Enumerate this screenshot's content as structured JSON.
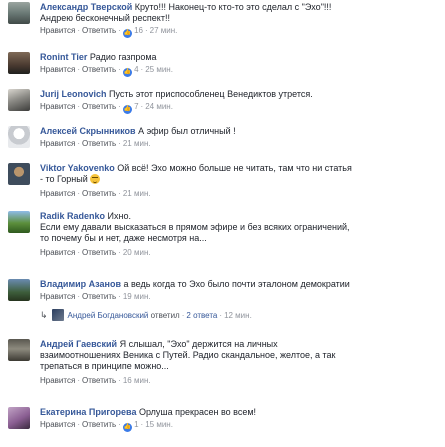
{
  "actions": {
    "like": "Нравится",
    "reply": "Ответить",
    "dot": "·"
  },
  "comments": [
    {
      "author": "Александр Тверской",
      "text": "Круто!!! Наконец-то кто-то это сделал с \"Эхо\"!!!",
      "text2": "Андрею бесконечный респект!!",
      "reactions": "16",
      "time": "27 мин."
    },
    {
      "author": "Ronint Tier",
      "text": "Радио газпрома",
      "reactions": "4",
      "time": "25 мин."
    },
    {
      "author": "Jurij Leonovich",
      "text": "Пусть этот приспособленец Венедиктов утрется.",
      "reactions": "7",
      "time": "24 мин."
    },
    {
      "author": "Алексей Скрынников",
      "text": "А эфир был отличный !",
      "reactions": "",
      "time": "21 мин."
    },
    {
      "author": "Viktor Yakovenko",
      "text": "Ой всё! Эхо можно больше не читать, там что ни статья",
      "text2": "- то Горный",
      "reactions": "",
      "time": "21 мин."
    },
    {
      "author": "Radik Radenko",
      "text": "Ихно.",
      "text2": "Если ему давали высказаться в прямом эфире и без всяких ограничений,",
      "text3": "то почему бы и нет, даже несмотря на...",
      "reactions": "",
      "time": "20 мин."
    },
    {
      "author": "Владимир Азанов",
      "text": "а ведь когда то Эхо было почти эталоном демократии",
      "reactions": "",
      "time": "19 мин."
    },
    {
      "author": "Андрей Гаевский",
      "text": "Я слышал, \"Эхо\" держится на личных",
      "text2": "взаимоотношениях Веника с Путей. Радио скандальное, желтое, а так",
      "text3": "трепаться в принципе можно...",
      "reactions": "",
      "time": "16 мин."
    },
    {
      "author": "Екатерина Пригорева",
      "text": "Орлуша прекрасен во всем!",
      "reactions": "1",
      "time": "15 мин."
    }
  ],
  "reply_summary": {
    "name": "Андрей Богдановский",
    "verb": "ответил",
    "count": "2 ответа",
    "time": "12 мин."
  },
  "colors": {
    "link": "#365899",
    "meta": "#90949c",
    "reaction": "#3b7be8"
  }
}
